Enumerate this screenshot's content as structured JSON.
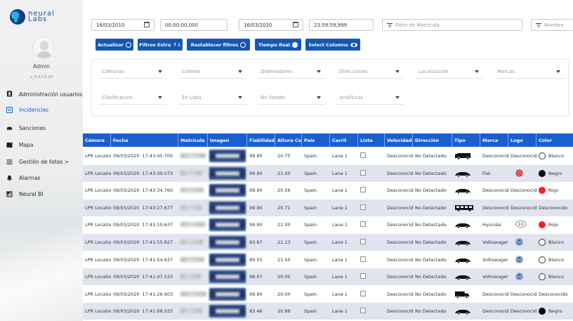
{
  "brand": {
    "name_top": "neural",
    "name_bottom": "Labs"
  },
  "user": {
    "name": "Admin",
    "version": "v_4.12.0.20"
  },
  "nav": [
    {
      "label": "Administración usuarios",
      "icon": "user-id-icon",
      "two_line": true
    },
    {
      "label": "Incidencias",
      "icon": "list-alert-icon",
      "active": true
    },
    {
      "label": "Sanciones",
      "icon": "car-icon"
    },
    {
      "label": "Mapa",
      "icon": "map-icon"
    },
    {
      "label": "Gestión de listas >",
      "icon": "list-icon"
    },
    {
      "label": "Alarmas",
      "icon": "bell-icon"
    },
    {
      "label": "Neural BI",
      "icon": "chart-icon"
    }
  ],
  "filters": {
    "date_from": "16/03/2010",
    "time_from": "00:00:00,000",
    "date_to": "16/03/2020",
    "time_to": "23:59:59,999",
    "plate_placeholder": "Filtro de Matrícula",
    "name_placeholder": "Nombre"
  },
  "buttons": [
    {
      "label": "Actualizar",
      "icon": "refresh-icon"
    },
    {
      "label": "Filtros Extra",
      "icon": "sort-arrows-icon"
    },
    {
      "label": "Restablecer filtros",
      "icon": "reset-icon"
    },
    {
      "label": "Tiempo Real",
      "icon": "realtime-icon"
    },
    {
      "label": "Select Columns",
      "icon": "eye-icon"
    }
  ],
  "selects_row1": [
    "Cámaras",
    "Colores",
    "Ordenadores",
    "Direcciones",
    "Localización",
    "Marcas"
  ],
  "selects_row2": [
    "Clasificación",
    "En Lista",
    "No listado",
    "Analíticas"
  ],
  "columns": [
    "Cámara",
    "Fecha",
    "Matrícula",
    "Imagen",
    "Fiabilidad",
    "Altura Carácter",
    "País",
    "Carril",
    "Lista",
    "Velocidad",
    "Dirección",
    "Tipo",
    "Marca",
    "Logo",
    "Color"
  ],
  "rows": [
    {
      "camera": "LPR Locatio",
      "date": "09/03/2020",
      "time": "17:43:45.700",
      "reliability": "99.90",
      "height": "20.75",
      "country": "Spain",
      "lane": "Lane 1",
      "speed": "Desconocid",
      "direction": "No Detectado",
      "type": "van",
      "brand": "Desconocid",
      "logo": "Desconocid",
      "logo_icon": "",
      "color": "Blanco",
      "color_hex": "#ffffff"
    },
    {
      "camera": "LPR Locatio",
      "date": "09/03/2020",
      "time": "17:43:39.073",
      "reliability": "99.90",
      "height": "21.00",
      "country": "Spain",
      "lane": "Lane 1",
      "speed": "Desconocid",
      "direction": "No Detectado",
      "type": "car",
      "brand": "Fiat",
      "logo": "",
      "logo_icon": "fiat",
      "color": "Negro",
      "color_hex": "#000000"
    },
    {
      "camera": "LPR Locatio",
      "date": "09/03/2020",
      "time": "17:43:34.760",
      "reliability": "99.90",
      "height": "20.56",
      "country": "Spain",
      "lane": "Lane 1",
      "speed": "Desconocid",
      "direction": "No Detectado",
      "type": "car",
      "brand": "Desconocid",
      "logo": "Desconocid",
      "logo_icon": "",
      "color": "Rojo",
      "color_hex": "#ff1c1c"
    },
    {
      "camera": "LPR Locatio",
      "date": "09/03/2020",
      "time": "17:43:27.677",
      "reliability": "99.90",
      "height": "20.71",
      "country": "Spain",
      "lane": "Lane 1",
      "speed": "Desconocid",
      "direction": "No Detectado",
      "type": "bus",
      "brand": "Desconocid",
      "logo": "Desconocid",
      "logo_icon": "",
      "color": "Desconocido",
      "color_hex": ""
    },
    {
      "camera": "LPR Locatio",
      "date": "09/03/2020",
      "time": "17:43:10.637",
      "reliability": "99.90",
      "height": "21.00",
      "country": "Spain",
      "lane": "Lane 1",
      "speed": "Desconocid",
      "direction": "No Detectado",
      "type": "car",
      "brand": "Hyundai",
      "logo": "",
      "logo_icon": "hyundai",
      "color": "Rojo",
      "color_hex": "#ff1c1c"
    },
    {
      "camera": "LPR Locatio",
      "date": "09/03/2020",
      "time": "17:41:55.627",
      "reliability": "93.97",
      "height": "21.13",
      "country": "Spain",
      "lane": "Lane 1",
      "speed": "Desconocid",
      "direction": "No Detectado",
      "type": "car",
      "brand": "Volkswagen",
      "logo": "",
      "logo_icon": "vw",
      "color": "Blanco",
      "color_hex": "#ffffff"
    },
    {
      "camera": "LPR Locatio",
      "date": "09/03/2020",
      "time": "17:41:54.637",
      "reliability": "89.55",
      "height": "21.50",
      "country": "Spain",
      "lane": "Lane 1",
      "speed": "Desconocid",
      "direction": "No Detectado",
      "type": "car",
      "brand": "Volkswagen",
      "logo": "",
      "logo_icon": "vw",
      "color": "Blanco",
      "color_hex": "#ffffff"
    },
    {
      "camera": "LPR Locatio",
      "date": "09/03/2020",
      "time": "17:41:47.533",
      "reliability": "98.07",
      "height": "20.00",
      "country": "Spain",
      "lane": "Lane 1",
      "speed": "Desconocid",
      "direction": "No Detectado",
      "type": "car",
      "brand": "Volkswagen",
      "logo": "",
      "logo_icon": "vw",
      "color": "Blanco",
      "color_hex": "#ffffff"
    },
    {
      "camera": "LPR Locatio",
      "date": "09/03/2020",
      "time": "17:41:26.903",
      "reliability": "99.90",
      "height": "20.00",
      "country": "Spain",
      "lane": "Lane 1",
      "speed": "Desconocid",
      "direction": "No Detectado",
      "type": "truck",
      "brand": "Desconocid",
      "logo": "Desconocid",
      "logo_icon": "",
      "color": "Desconocido",
      "color_hex": ""
    },
    {
      "camera": "LPR Locatio",
      "date": "09/03/2020",
      "time": "17:41:08.033",
      "reliability": "83.46",
      "height": "20.89",
      "country": "Spain",
      "lane": "Lane 1",
      "speed": "Desconocid",
      "direction": "No Detectado",
      "type": "car",
      "brand": "Desconocid",
      "logo": "Desconocid",
      "logo_icon": "",
      "color": "Negro",
      "color_hex": "#000000"
    }
  ]
}
